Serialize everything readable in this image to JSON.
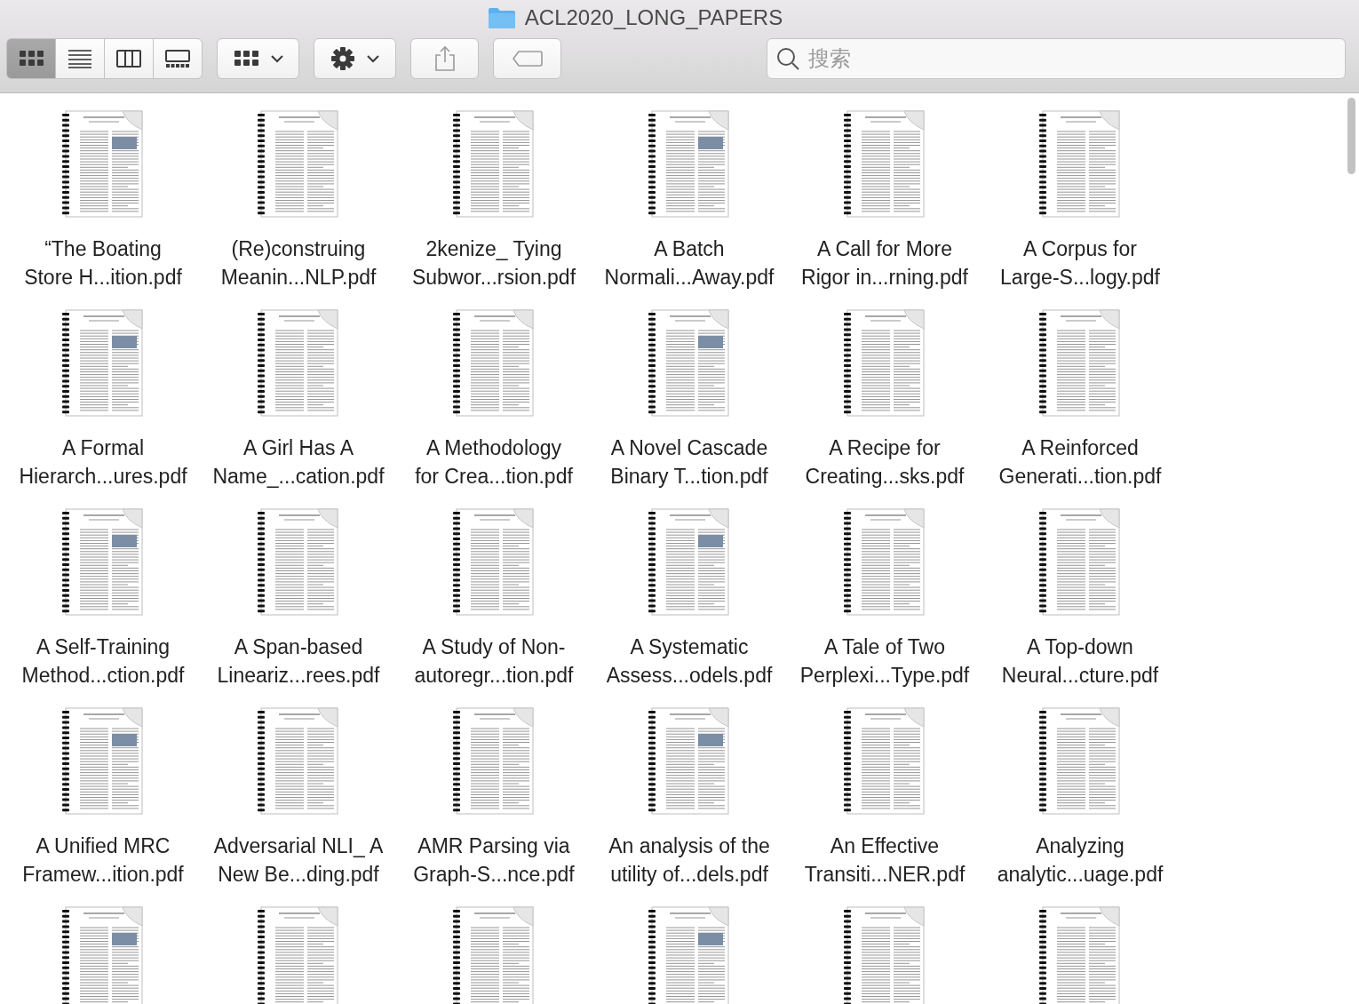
{
  "window": {
    "title": "ACL2020_LONG_PAPERS"
  },
  "toolbar": {
    "view_modes": [
      {
        "kind": "icons",
        "selected": true
      },
      {
        "kind": "list",
        "selected": false
      },
      {
        "kind": "columns",
        "selected": false
      },
      {
        "kind": "gallery",
        "selected": false
      }
    ],
    "search": {
      "placeholder": "搜索"
    }
  },
  "files": [
    {
      "kind": "pdf",
      "label_lines": [
        "“The Boating",
        "Store H...ition.pdf"
      ]
    },
    {
      "kind": "pdf",
      "label_lines": [
        "(Re)construing",
        "Meanin...NLP.pdf"
      ]
    },
    {
      "kind": "pdf",
      "label_lines": [
        "2kenize_ Tying",
        "Subwor...rsion.pdf"
      ]
    },
    {
      "kind": "pdf",
      "label_lines": [
        "A Batch",
        "Normali...Away.pdf"
      ]
    },
    {
      "kind": "pdf",
      "label_lines": [
        "A Call for More",
        "Rigor in...rning.pdf"
      ]
    },
    {
      "kind": "pdf",
      "label_lines": [
        "A Corpus for",
        "Large-S...logy.pdf"
      ]
    },
    {
      "kind": "pdf",
      "label_lines": [
        "A Formal",
        "Hierarch...ures.pdf"
      ]
    },
    {
      "kind": "pdf",
      "label_lines": [
        "A Girl Has A",
        "Name_...cation.pdf"
      ]
    },
    {
      "kind": "pdf",
      "label_lines": [
        "A Methodology",
        "for Crea...tion.pdf"
      ]
    },
    {
      "kind": "pdf",
      "label_lines": [
        "A Novel Cascade",
        "Binary T...tion.pdf"
      ]
    },
    {
      "kind": "pdf",
      "label_lines": [
        "A Recipe for",
        "Creating...sks.pdf"
      ]
    },
    {
      "kind": "pdf",
      "label_lines": [
        "A Reinforced",
        "Generati...tion.pdf"
      ]
    },
    {
      "kind": "pdf",
      "label_lines": [
        "A Self-Training",
        "Method...ction.pdf"
      ]
    },
    {
      "kind": "pdf",
      "label_lines": [
        "A Span-based",
        "Lineariz...rees.pdf"
      ]
    },
    {
      "kind": "pdf",
      "label_lines": [
        "A Study of Non-",
        "autoregr...tion.pdf"
      ]
    },
    {
      "kind": "pdf",
      "label_lines": [
        "A Systematic",
        "Assess...odels.pdf"
      ]
    },
    {
      "kind": "pdf",
      "label_lines": [
        "A Tale of Two",
        "Perplexi...Type.pdf"
      ]
    },
    {
      "kind": "pdf",
      "label_lines": [
        "A Top-down",
        "Neural...cture.pdf"
      ]
    },
    {
      "kind": "pdf",
      "label_lines": [
        "A Unified MRC",
        "Framew...ition.pdf"
      ]
    },
    {
      "kind": "pdf",
      "label_lines": [
        "Adversarial NLI_ A",
        "New Be...ding.pdf"
      ]
    },
    {
      "kind": "pdf",
      "label_lines": [
        "AMR Parsing via",
        "Graph-S...nce.pdf"
      ]
    },
    {
      "kind": "pdf",
      "label_lines": [
        "An analysis of the",
        "utility of...dels.pdf"
      ]
    },
    {
      "kind": "pdf",
      "label_lines": [
        "An Effective",
        "Transiti...NER.pdf"
      ]
    },
    {
      "kind": "pdf",
      "label_lines": [
        "Analyzing",
        "analytic...uage.pdf"
      ]
    },
    {
      "kind": "pdf"
    },
    {
      "kind": "pdf"
    },
    {
      "kind": "pdf"
    },
    {
      "kind": "pdf"
    },
    {
      "kind": "pdf"
    },
    {
      "kind": "pdf"
    }
  ]
}
